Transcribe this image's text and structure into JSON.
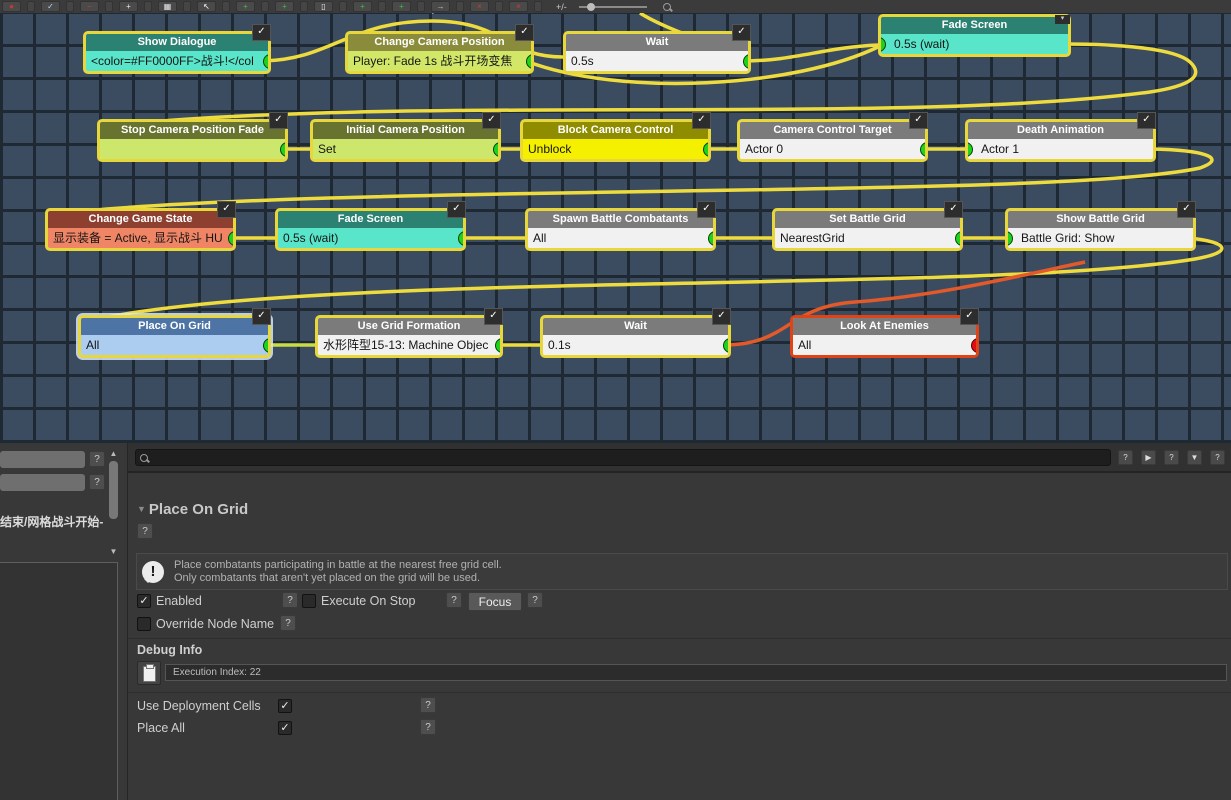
{
  "toolbar": {
    "zoom_label": "+/-",
    "icons": [
      {
        "name": "record-icon",
        "glyph": "●",
        "tint": "#c43a2e"
      },
      {
        "name": "separator-handle",
        "thin": true
      },
      {
        "name": "check-icon",
        "glyph": "✓",
        "tint": "#bcd6ff"
      },
      {
        "name": "separator-handle",
        "thin": true
      },
      {
        "name": "remove-line-icon",
        "glyph": "−",
        "tint": "#d23b2b"
      },
      {
        "name": "separator-handle",
        "thin": true
      },
      {
        "name": "move-icon",
        "glyph": "+",
        "tint": "#e8e8e8"
      },
      {
        "name": "separator-handle",
        "thin": true
      },
      {
        "name": "grid-icon",
        "glyph": "▦",
        "tint": "#e8e8e8"
      },
      {
        "name": "separator-handle",
        "thin": true
      },
      {
        "name": "cursor-icon",
        "glyph": "↖",
        "tint": "#ffffff"
      },
      {
        "name": "separator-handle",
        "thin": true
      },
      {
        "name": "add-node-icon",
        "glyph": "+",
        "tint": "#3fbf3f"
      },
      {
        "name": "separator-handle",
        "thin": true
      },
      {
        "name": "add-group-icon",
        "glyph": "+",
        "tint": "#3fbf3f"
      },
      {
        "name": "separator-handle",
        "thin": true
      },
      {
        "name": "document-icon",
        "glyph": "▯",
        "tint": "#eeeeee"
      },
      {
        "name": "separator-handle",
        "thin": true
      },
      {
        "name": "copy-add-icon",
        "glyph": "+",
        "tint": "#3fbf3f"
      },
      {
        "name": "separator-handle",
        "thin": true
      },
      {
        "name": "list-add-icon",
        "glyph": "+",
        "tint": "#3fbf3f"
      },
      {
        "name": "separator-handle",
        "thin": true
      },
      {
        "name": "forward-icon",
        "glyph": "→",
        "tint": "#cccccc"
      },
      {
        "name": "separator-handle",
        "thin": true
      },
      {
        "name": "delete-icon",
        "glyph": "×",
        "tint": "#d23b2b"
      },
      {
        "name": "separator-handle",
        "thin": true
      },
      {
        "name": "delete-all-icon",
        "glyph": "×",
        "tint": "#d23b2b"
      },
      {
        "name": "separator-handle",
        "thin": true
      }
    ]
  },
  "canvas": {
    "wire_colors": {
      "flow": "#eedc3e",
      "alt": "#c8dc46",
      "error": "#e2592a"
    },
    "nodes": [
      {
        "title": "Show Dialogue",
        "value": "<color=#FF0000FF>战斗!</col",
        "enabled": true
      },
      {
        "title": "Change Camera Position",
        "value": "Player: Fade 1s 战斗开场变焦",
        "enabled": true
      },
      {
        "title": "Wait",
        "value": "0.5s",
        "enabled": true
      },
      {
        "title": "Fade Screen",
        "value": "0.5s (wait)",
        "enabled": true
      },
      {
        "title": "Stop Camera Position Fade",
        "value": "",
        "enabled": true
      },
      {
        "title": "Initial Camera Position",
        "value": "Set",
        "enabled": true
      },
      {
        "title": "Block Camera Control",
        "value": "Unblock",
        "enabled": true
      },
      {
        "title": "Camera Control Target",
        "value": "Actor 0",
        "enabled": true
      },
      {
        "title": "Death Animation",
        "value": "Actor 1",
        "enabled": true
      },
      {
        "title": "Change Game State",
        "value": "显示装备 = Active, 显示战斗 HU",
        "enabled": true
      },
      {
        "title": "Fade Screen",
        "value": "0.5s (wait)",
        "enabled": true
      },
      {
        "title": "Spawn Battle Combatants",
        "value": "All",
        "enabled": true
      },
      {
        "title": "Set Battle Grid",
        "value": "NearestGrid",
        "enabled": true
      },
      {
        "title": "Show Battle Grid",
        "value": "Battle Grid: Show",
        "enabled": true
      },
      {
        "title": "Place On Grid",
        "value": "All",
        "enabled": true
      },
      {
        "title": "Use Grid Formation",
        "value": "水形阵型15-13: Machine Objec",
        "enabled": true
      },
      {
        "title": "Wait",
        "value": "0.1s",
        "enabled": true
      },
      {
        "title": "Look At Enemies",
        "value": "All",
        "enabled": true
      }
    ],
    "collapse_glyph": "▾"
  },
  "left_panel": {
    "note_text": "结束/网格战斗开始-",
    "question": "?"
  },
  "inspector": {
    "question": "?",
    "search_buttons": {
      "help1": "?",
      "play": "▶",
      "help2": "?",
      "dropdown": "▼",
      "help3": "?"
    },
    "section_title": "Place On Grid",
    "info_icon_glyph": "!",
    "info_line1": "Place combatants participating in battle at the nearest free grid cell.",
    "info_line2": "Only combatants that aren't yet placed on the grid will be used.",
    "enabled": {
      "label": "Enabled",
      "checked": true
    },
    "execute_on_stop": {
      "label": "Execute On Stop",
      "checked": false
    },
    "focus_button_label": "Focus",
    "override_node_name": {
      "label": "Override Node Name",
      "checked": false
    },
    "debug_info_label": "Debug Info",
    "execution_index_text": "Execution Index: 22",
    "use_deployment_cells": {
      "label": "Use Deployment Cells",
      "checked": true
    },
    "place_all": {
      "label": "Place All",
      "checked": true
    }
  }
}
